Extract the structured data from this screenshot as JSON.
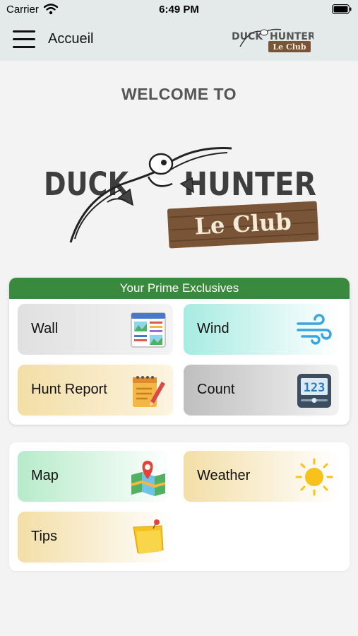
{
  "status_bar": {
    "carrier": "Carrier",
    "time": "6:49 PM"
  },
  "nav": {
    "title": "Accueil"
  },
  "logo": {
    "line1": "DUCK",
    "line2": "HUNTER",
    "plaque": "Le Club"
  },
  "welcome": "WELCOME TO",
  "prime": {
    "header": "Your Prime Exclusives",
    "tiles": [
      {
        "label": "Wall",
        "icon": "wall-icon"
      },
      {
        "label": "Wind",
        "icon": "wind-icon"
      },
      {
        "label": "Hunt Report",
        "icon": "notepad-icon"
      },
      {
        "label": "Count",
        "icon": "counter-icon"
      }
    ],
    "header_color": "#3a8a3e"
  },
  "general": {
    "tiles": [
      {
        "label": "Map",
        "icon": "map-icon"
      },
      {
        "label": "Weather",
        "icon": "sun-icon"
      },
      {
        "label": "Tips",
        "icon": "sticky-note-icon"
      }
    ]
  }
}
